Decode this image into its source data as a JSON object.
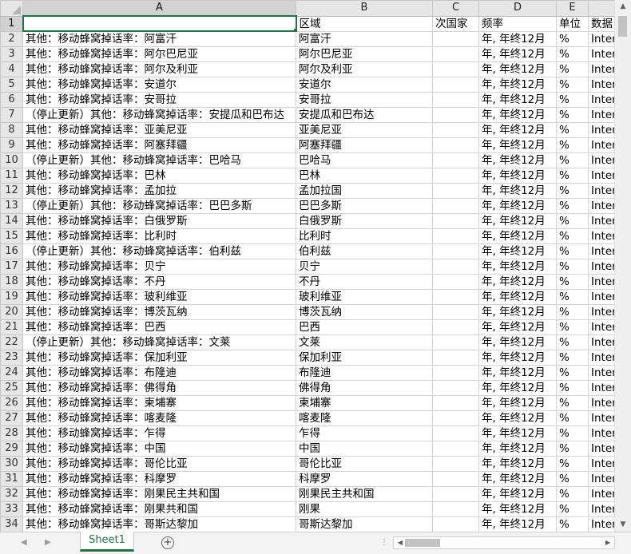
{
  "columns": [
    "A",
    "B",
    "C",
    "D",
    "E",
    ""
  ],
  "header_row": [
    "",
    "区域",
    "次国家",
    "频率",
    "单位",
    "数据"
  ],
  "rows": [
    [
      "其他：移动蜂窝掉话率：阿富汗",
      "阿富汗",
      "",
      "年, 年终12月",
      "%",
      "Inter"
    ],
    [
      "其他：移动蜂窝掉话率：阿尔巴尼亚",
      "阿尔巴尼亚",
      "",
      "年, 年终12月",
      "%",
      "Inter"
    ],
    [
      "其他：移动蜂窝掉话率：阿尔及利亚",
      "阿尔及利亚",
      "",
      "年, 年终12月",
      "%",
      "Inter"
    ],
    [
      "其他：移动蜂窝掉话率：安道尔",
      "安道尔",
      "",
      "年, 年终12月",
      "%",
      "Inter"
    ],
    [
      "其他：移动蜂窝掉话率：安哥拉",
      "安哥拉",
      "",
      "年, 年终12月",
      "%",
      "Inter"
    ],
    [
      "（停止更新）其他：移动蜂窝掉话率：安提瓜和巴布达",
      "安提瓜和巴布达",
      "",
      "年, 年终12月",
      "%",
      "Inter"
    ],
    [
      "其他：移动蜂窝掉话率：亚美尼亚",
      "亚美尼亚",
      "",
      "年, 年终12月",
      "%",
      "Inter"
    ],
    [
      "其他：移动蜂窝掉话率：阿塞拜疆",
      "阿塞拜疆",
      "",
      "年, 年终12月",
      "%",
      "Inter"
    ],
    [
      "（停止更新）其他：移动蜂窝掉话率：巴哈马",
      "巴哈马",
      "",
      "年, 年终12月",
      "%",
      "Inter"
    ],
    [
      "其他：移动蜂窝掉话率：巴林",
      "巴林",
      "",
      "年, 年终12月",
      "%",
      "Inter"
    ],
    [
      "其他：移动蜂窝掉话率：孟加拉",
      "孟加拉国",
      "",
      "年, 年终12月",
      "%",
      "Inter"
    ],
    [
      "（停止更新）其他：移动蜂窝掉话率：巴巴多斯",
      "巴巴多斯",
      "",
      "年, 年终12月",
      "%",
      "Inter"
    ],
    [
      "其他：移动蜂窝掉话率：白俄罗斯",
      "白俄罗斯",
      "",
      "年, 年终12月",
      "%",
      "Inter"
    ],
    [
      "其他：移动蜂窝掉话率：比利时",
      "比利时",
      "",
      "年, 年终12月",
      "%",
      "Inter"
    ],
    [
      "（停止更新）其他：移动蜂窝掉话率：伯利兹",
      "伯利兹",
      "",
      "年, 年终12月",
      "%",
      "Inter"
    ],
    [
      "其他：移动蜂窝掉话率：贝宁",
      "贝宁",
      "",
      "年, 年终12月",
      "%",
      "Inter"
    ],
    [
      "其他：移动蜂窝掉话率：不丹",
      "不丹",
      "",
      "年, 年终12月",
      "%",
      "Inter"
    ],
    [
      "其他：移动蜂窝掉话率：玻利维亚",
      "玻利维亚",
      "",
      "年, 年终12月",
      "%",
      "Inter"
    ],
    [
      "其他：移动蜂窝掉话率：博茨瓦纳",
      "博茨瓦纳",
      "",
      "年, 年终12月",
      "%",
      "Inter"
    ],
    [
      "其他：移动蜂窝掉话率：巴西",
      "巴西",
      "",
      "年, 年终12月",
      "%",
      "Inter"
    ],
    [
      "（停止更新）其他：移动蜂窝掉话率：文莱",
      "文莱",
      "",
      "年, 年终12月",
      "%",
      "Inter"
    ],
    [
      "其他：移动蜂窝掉话率：保加利亚",
      "保加利亚",
      "",
      "年, 年终12月",
      "%",
      "Inter"
    ],
    [
      "其他：移动蜂窝掉话率：布隆迪",
      "布隆迪",
      "",
      "年, 年终12月",
      "%",
      "Inter"
    ],
    [
      "其他：移动蜂窝掉话率：佛得角",
      "佛得角",
      "",
      "年, 年终12月",
      "%",
      "Inter"
    ],
    [
      "其他：移动蜂窝掉话率：柬埔寨",
      "柬埔寨",
      "",
      "年, 年终12月",
      "%",
      "Inter"
    ],
    [
      "其他：移动蜂窝掉话率：喀麦隆",
      "喀麦隆",
      "",
      "年, 年终12月",
      "%",
      "Inter"
    ],
    [
      "其他：移动蜂窝掉话率：乍得",
      "乍得",
      "",
      "年, 年终12月",
      "%",
      "Inter"
    ],
    [
      "其他：移动蜂窝掉话率：中国",
      "中国",
      "",
      "年, 年终12月",
      "%",
      "Inter"
    ],
    [
      "其他：移动蜂窝掉话率：哥伦比亚",
      "哥伦比亚",
      "",
      "年, 年终12月",
      "%",
      "Inter"
    ],
    [
      "其他：移动蜂窝掉话率：科摩罗",
      "科摩罗",
      "",
      "年, 年终12月",
      "%",
      "Inter"
    ],
    [
      "其他：移动蜂窝掉话率：刚果民主共和国",
      "刚果民主共和国",
      "",
      "年, 年终12月",
      "%",
      "Inter"
    ],
    [
      "其他：移动蜂窝掉话率：刚果共和国",
      "刚果",
      "",
      "年, 年终12月",
      "%",
      "Inter"
    ],
    [
      "其他：移动蜂窝掉话率：哥斯达黎加",
      "哥斯达黎加",
      "",
      "年, 年终12月",
      "%",
      "Inter"
    ]
  ],
  "sheet_tab": "Sheet1",
  "add_sheet_symbol": "+",
  "icons": {
    "sheet_prev": "◀",
    "sheet_next": "▶",
    "scroll_up": "▲",
    "scroll_down": "▼",
    "scroll_left": "◀",
    "scroll_right": "▶",
    "split": "⋮"
  },
  "colors": {
    "accent": "#217346",
    "header_bg": "#e6e6e6",
    "gridline": "#d4d4d4"
  }
}
